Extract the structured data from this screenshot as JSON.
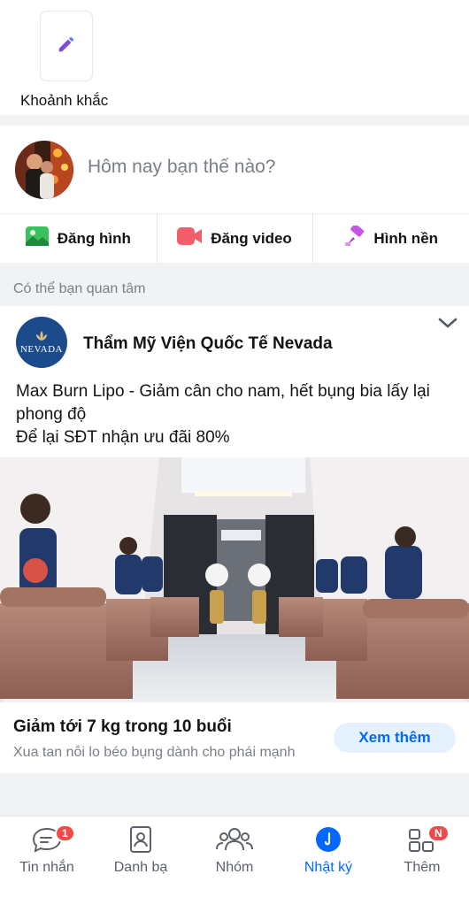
{
  "moments": {
    "label": "Khoảnh khắc",
    "icon": "pencil-icon"
  },
  "status": {
    "prompt": "Hôm nay bạn thế nào?"
  },
  "actions": [
    {
      "label": "Đăng hình",
      "icon": "image-icon",
      "color": "#3cc15f"
    },
    {
      "label": "Đăng video",
      "icon": "video-icon",
      "color": "#f25e6b"
    },
    {
      "label": "Hình nền",
      "icon": "paint-brush-icon",
      "color": "#c455e6"
    }
  ],
  "suggestions": {
    "label": "Có thể bạn quan tâm"
  },
  "ad": {
    "logo_text": "NEVADA",
    "advertiser": "Thẩm Mỹ Viện Quốc Tế Nevada",
    "text_line1": "Max Burn Lipo - Giảm cân cho nam, hết bụng bia lấy lại phong độ",
    "text_line2": "Để lại SĐT nhận ưu đãi 80%",
    "headline": "Giảm tới 7 kg trong 10 buổi",
    "subline": "Xua tan nỗi lo béo bụng dành cho phái mạnh",
    "cta": "Xem thêm"
  },
  "tabs": [
    {
      "label": "Tin nhắn",
      "icon": "chat-icon",
      "badge": "1"
    },
    {
      "label": "Danh bạ",
      "icon": "contacts-icon"
    },
    {
      "label": "Nhóm",
      "icon": "group-icon"
    },
    {
      "label": "Nhật ký",
      "icon": "timeline-icon",
      "active": true
    },
    {
      "label": "Thêm",
      "icon": "grid-icon",
      "badge": "N"
    }
  ],
  "colors": {
    "accent": "#0068ff",
    "badge": "#ef4a4a",
    "separator": "#f1f2f4"
  }
}
